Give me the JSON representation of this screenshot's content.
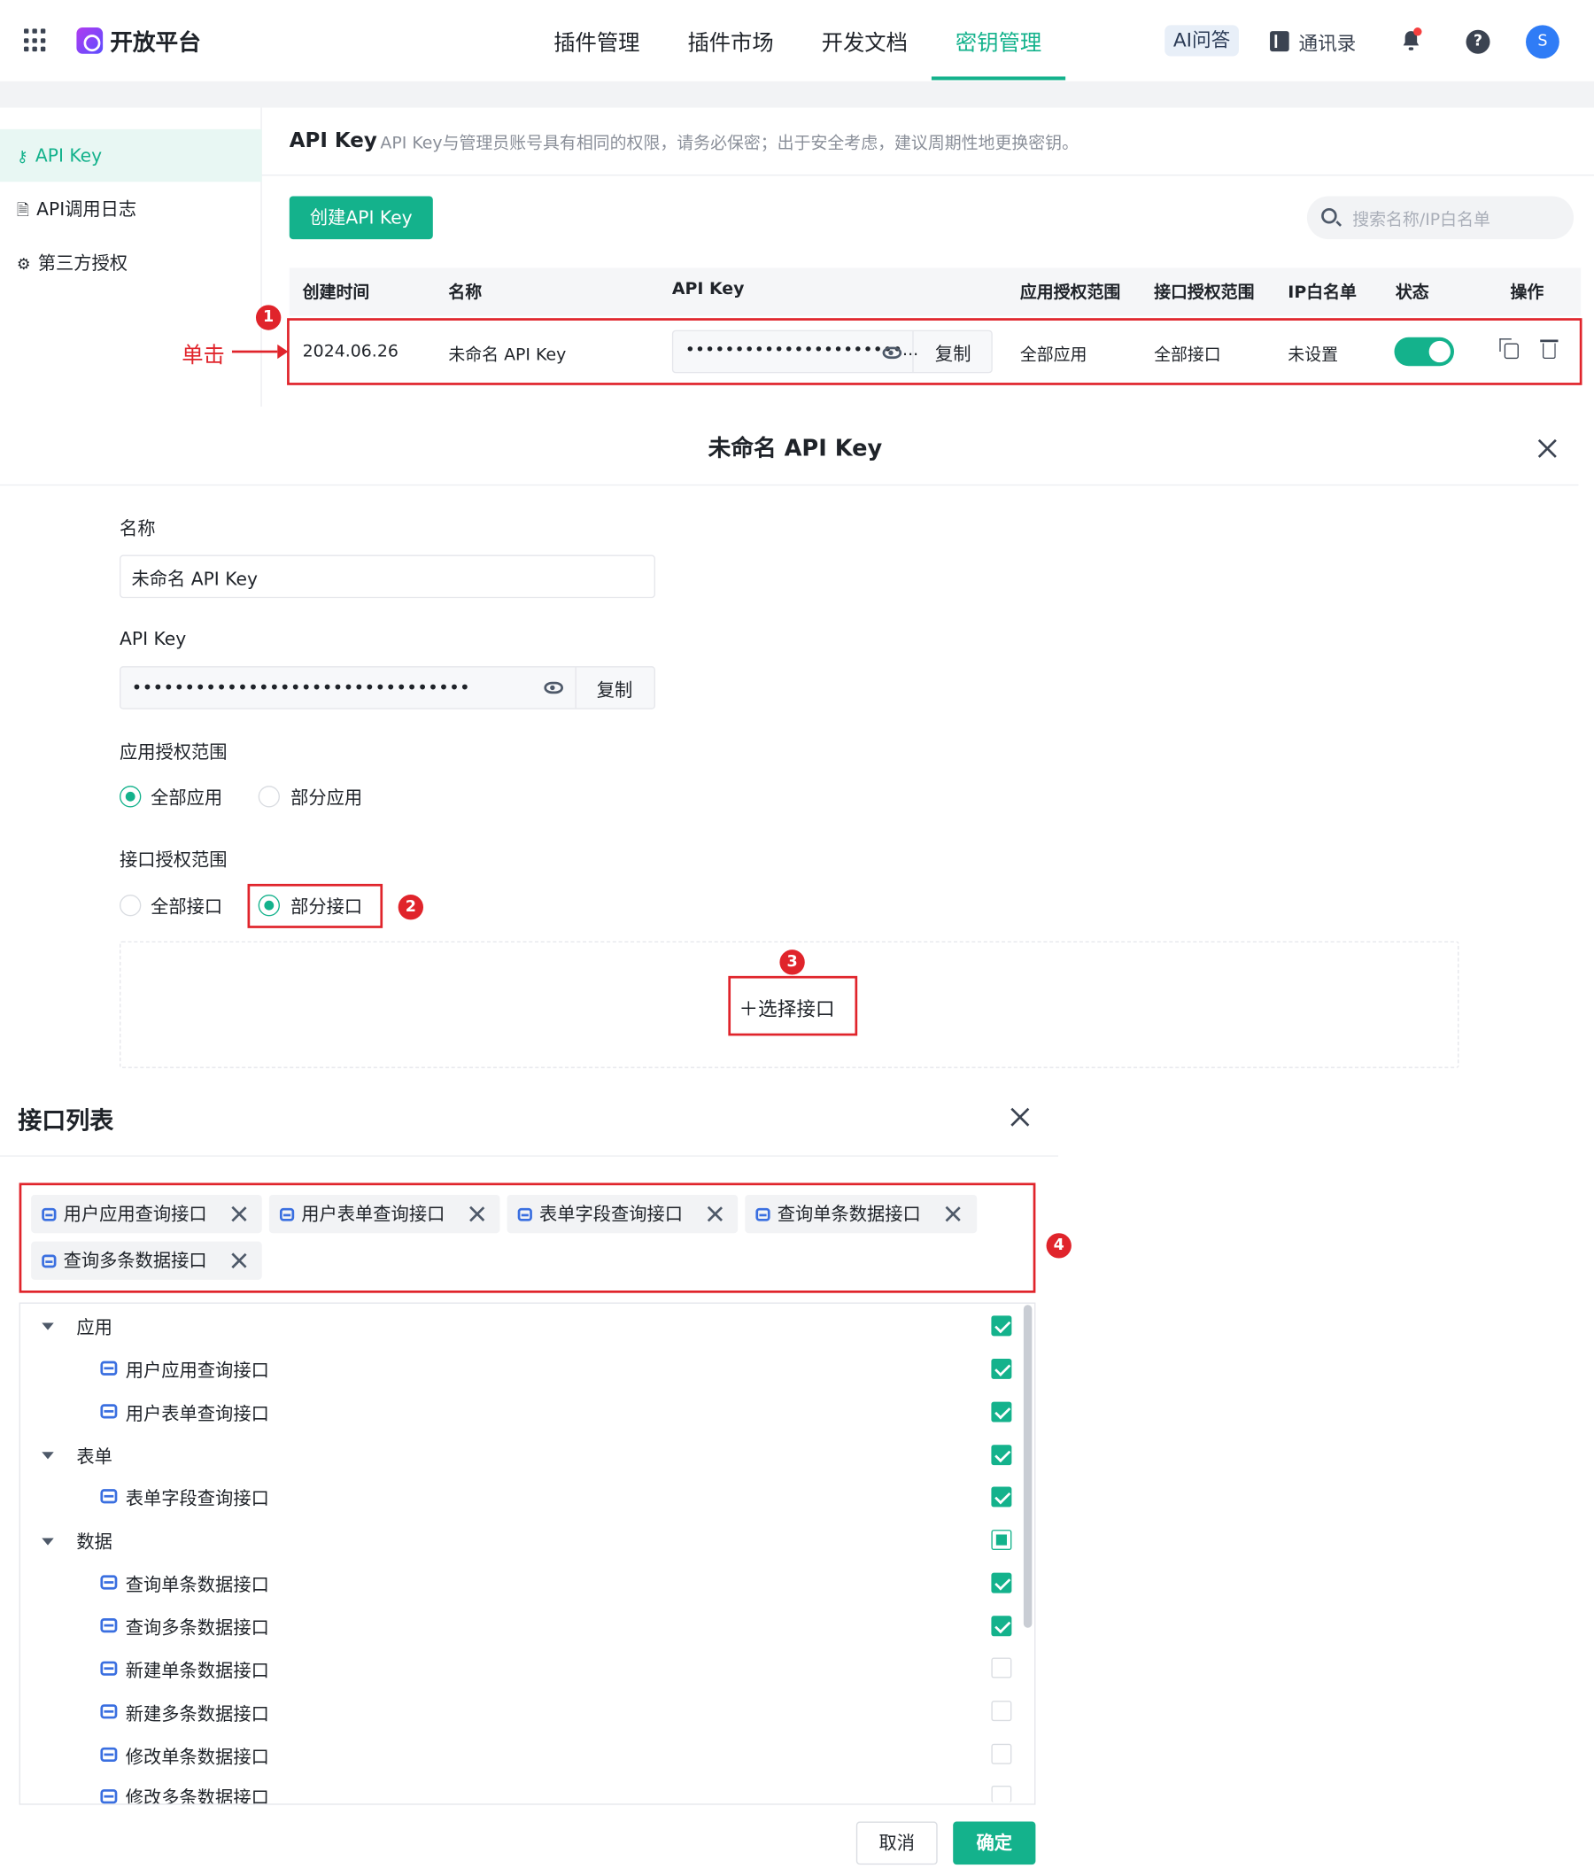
{
  "topbar": {
    "brand": "开放平台",
    "nav": [
      "插件管理",
      "插件市场",
      "开发文档",
      "密钥管理"
    ],
    "active_nav": "密钥管理",
    "ai_qa": "AI问答",
    "contacts": "通讯录",
    "avatar_letter": "S",
    "help": "?"
  },
  "sidebar": {
    "items": [
      {
        "label": "API Key",
        "icon": "key-icon",
        "active": true
      },
      {
        "label": "API调用日志",
        "icon": "log-icon",
        "active": false
      },
      {
        "label": "第三方授权",
        "icon": "auth-icon",
        "active": false
      }
    ]
  },
  "header": {
    "title": "API Key",
    "description": "API Key与管理员账号具有相同的权限，请务必保密；出于安全考虑，建议周期性地更换密钥。"
  },
  "toolbar": {
    "create_label": "创建API Key",
    "search_placeholder": "搜索名称/IP白名单"
  },
  "table": {
    "columns": [
      "创建时间",
      "名称",
      "API Key",
      "应用授权范围",
      "接口授权范围",
      "IP白名单",
      "状态",
      "操作"
    ],
    "row": {
      "created": "2024.06.26",
      "name": "未命名 API Key",
      "key_masked": "••••••••••••••••••••••...",
      "copy": "复制",
      "app_scope": "全部应用",
      "api_scope": "全部接口",
      "ip_whitelist": "未设置",
      "enabled": true
    }
  },
  "annotations": {
    "click_label": "单击",
    "steps": [
      "1",
      "2",
      "3",
      "4"
    ]
  },
  "dialog": {
    "title": "未命名 API Key",
    "name_label": "名称",
    "name_value": "未命名 API Key",
    "key_label": "API Key",
    "key_masked": "••••••••••••••••••••••••••••••••",
    "copy": "复制",
    "app_scope_label": "应用授权范围",
    "app_scope_options": [
      "全部应用",
      "部分应用"
    ],
    "app_scope_selected": "全部应用",
    "api_scope_label": "接口授权范围",
    "api_scope_options": [
      "全部接口",
      "部分接口"
    ],
    "api_scope_selected": "部分接口",
    "select_api": "选择接口"
  },
  "api_list": {
    "title": "接口列表",
    "selected_chips": [
      "用户应用查询接口",
      "用户表单查询接口",
      "表单字段查询接口",
      "查询单条数据接口",
      "查询多条数据接口"
    ],
    "tree": [
      {
        "type": "group",
        "label": "应用",
        "state": "checked"
      },
      {
        "type": "api",
        "label": "用户应用查询接口",
        "state": "checked"
      },
      {
        "type": "api",
        "label": "用户表单查询接口",
        "state": "checked"
      },
      {
        "type": "group",
        "label": "表单",
        "state": "checked"
      },
      {
        "type": "api",
        "label": "表单字段查询接口",
        "state": "checked"
      },
      {
        "type": "group",
        "label": "数据",
        "state": "partial"
      },
      {
        "type": "api",
        "label": "查询单条数据接口",
        "state": "checked"
      },
      {
        "type": "api",
        "label": "查询多条数据接口",
        "state": "checked"
      },
      {
        "type": "api",
        "label": "新建单条数据接口",
        "state": "unchecked"
      },
      {
        "type": "api",
        "label": "新建多条数据接口",
        "state": "unchecked"
      },
      {
        "type": "api",
        "label": "修改单条数据接口",
        "state": "unchecked"
      },
      {
        "type": "api",
        "label": "修改多条数据接口",
        "state": "unchecked"
      }
    ],
    "cancel": "取消",
    "confirm": "确定"
  },
  "colors": {
    "accent": "#14b28c",
    "annotation": "#e0242b",
    "api_icon": "#3a6fe0"
  }
}
